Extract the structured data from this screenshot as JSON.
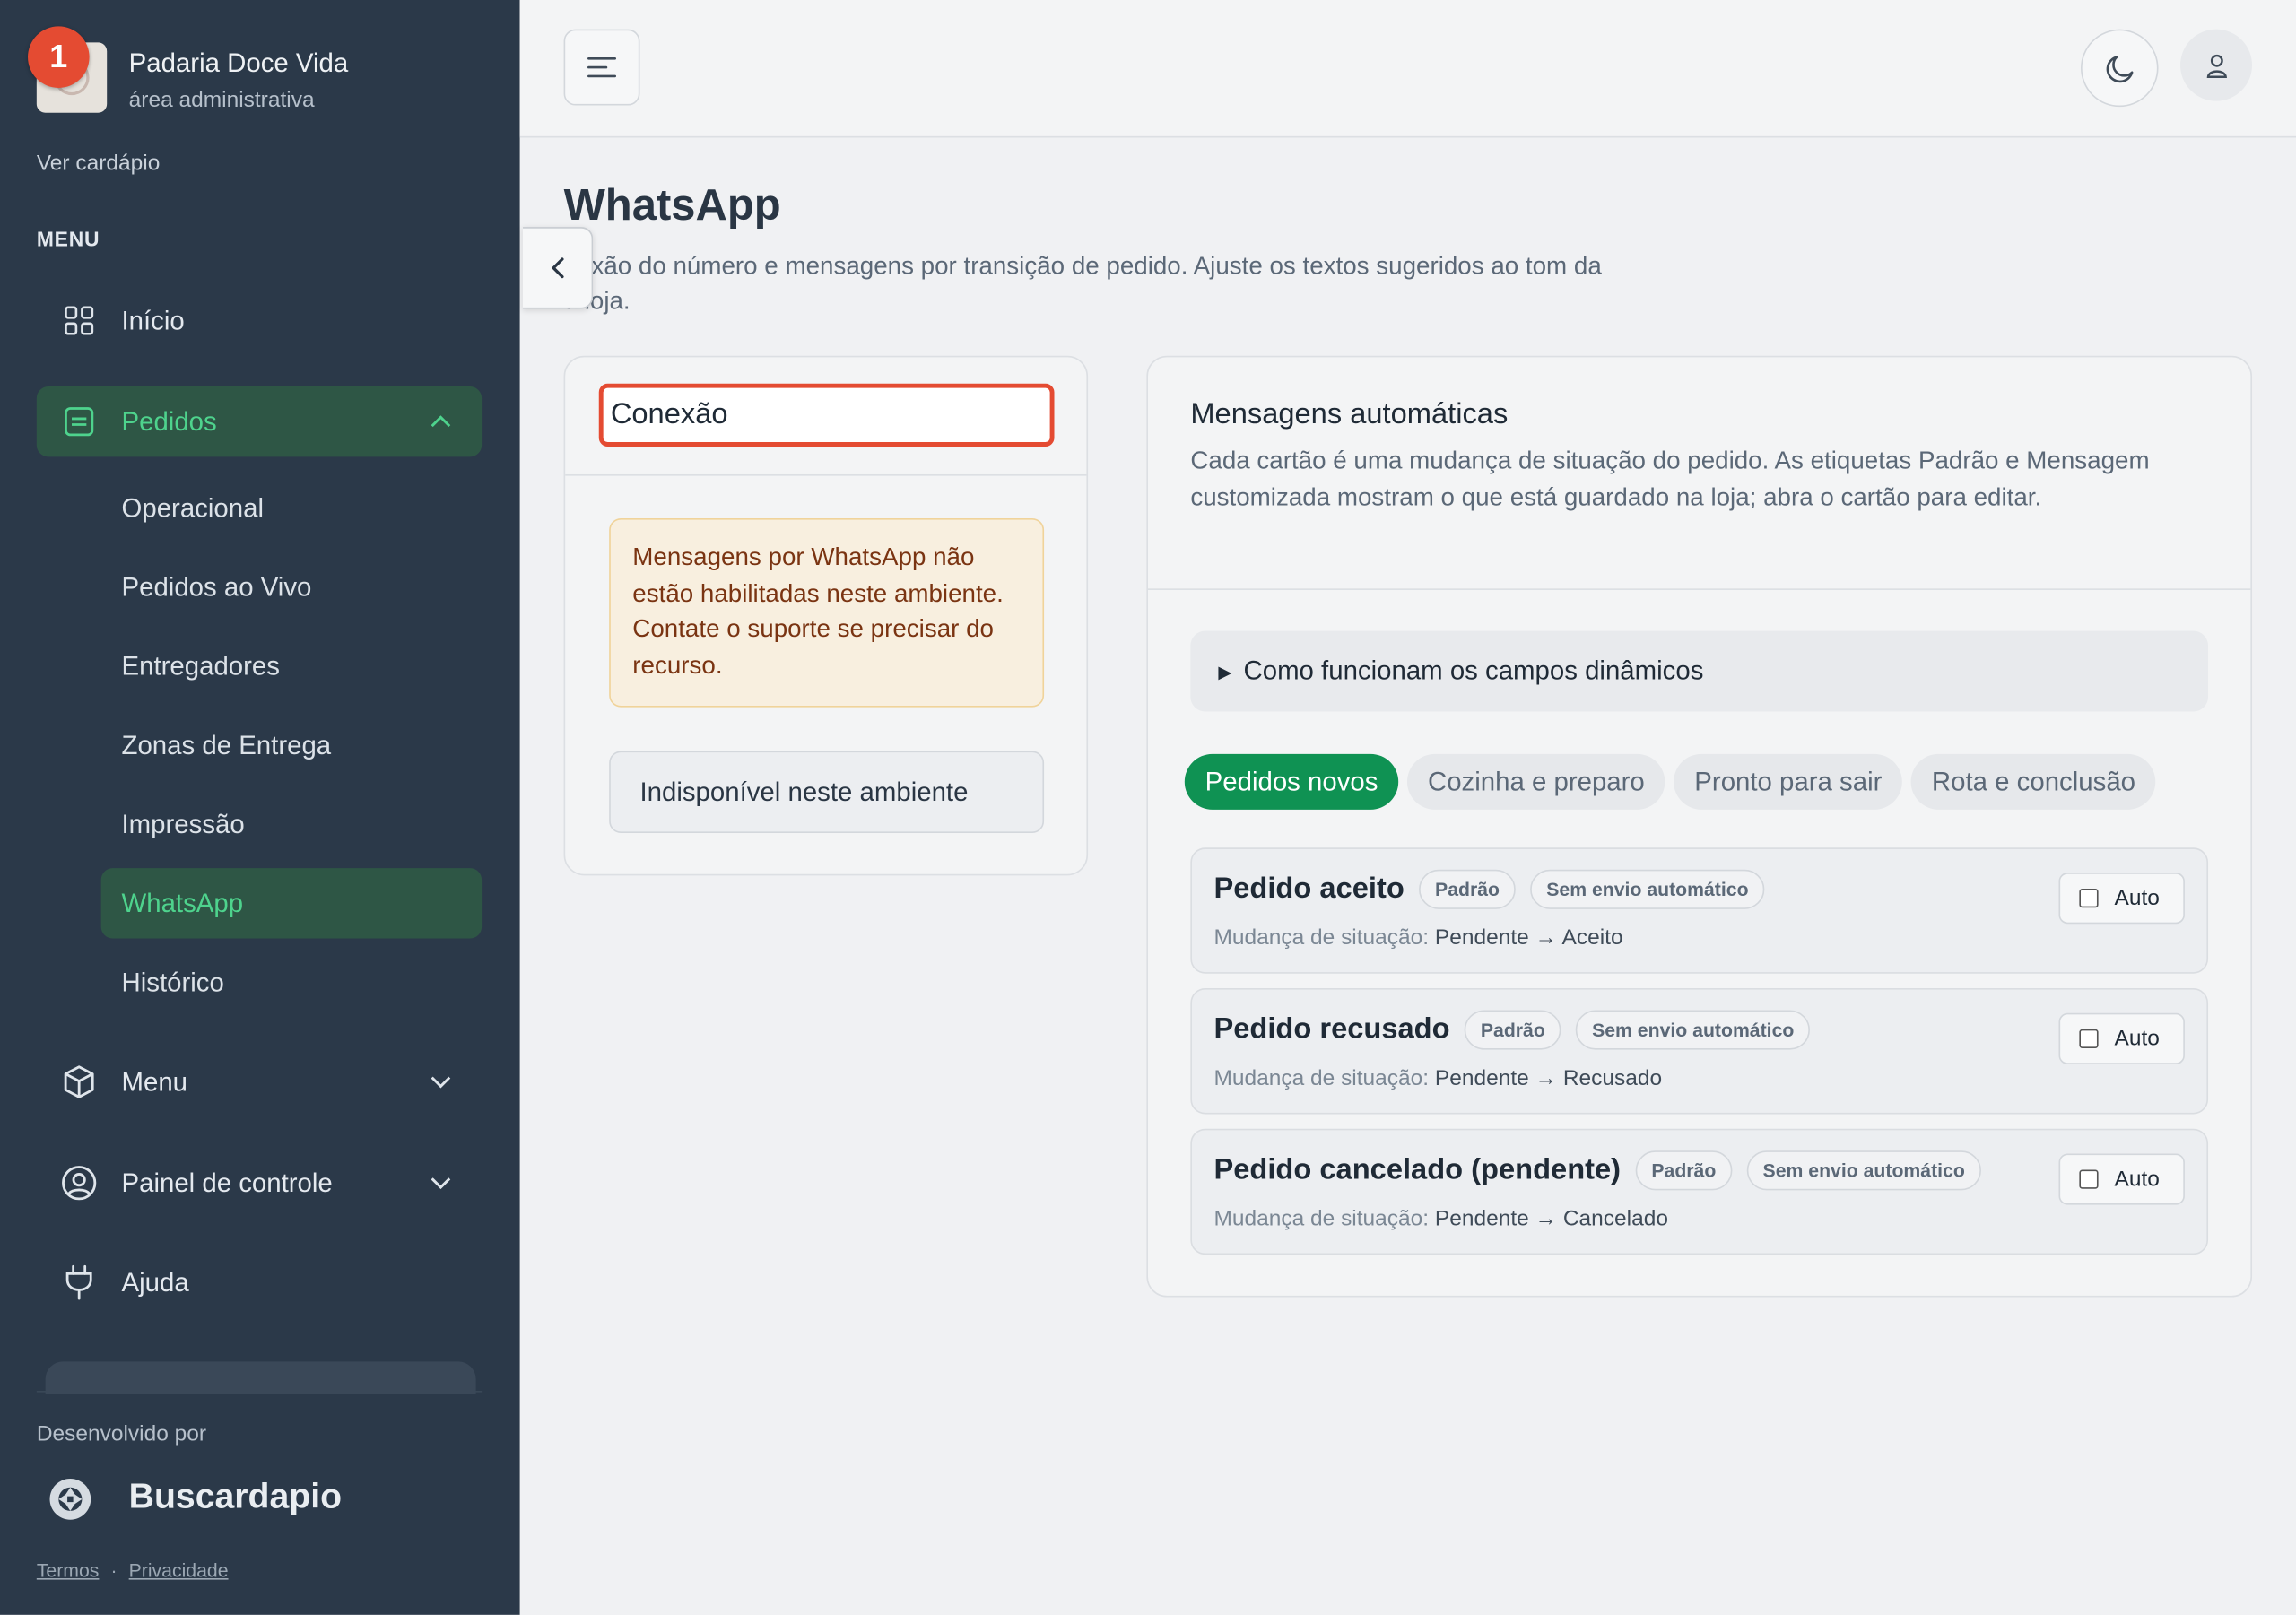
{
  "brand": {
    "name": "Padaria Doce Vida",
    "subtitle": "área administrativa",
    "notification_count": "1"
  },
  "sidebar": {
    "view_menu_link": "Ver cardápio",
    "menu_heading": "MENU",
    "items": [
      {
        "label": "Início",
        "icon": "grid-icon"
      },
      {
        "label": "Pedidos",
        "icon": "clipboard-icon",
        "expanded": true
      },
      {
        "label": "Menu",
        "icon": "box-icon"
      },
      {
        "label": "Painel de controle",
        "icon": "user-circle-icon"
      },
      {
        "label": "Ajuda",
        "icon": "plug-icon"
      }
    ],
    "pedidos_subitems": [
      "Operacional",
      "Pedidos ao Vivo",
      "Entregadores",
      "Zonas de Entrega",
      "Impressão",
      "WhatsApp",
      "Histórico"
    ],
    "active_subitem": "WhatsApp",
    "developed_by": "Desenvolvido por",
    "developer_name": "Buscardapio",
    "links": {
      "terms": "Termos",
      "privacy": "Privacidade",
      "separator": "·"
    }
  },
  "page": {
    "title": "WhatsApp",
    "description_line1": "nexão do número e mensagens por transição de pedido. Ajuste os textos sugeridos ao tom da",
    "description_line2": "a loja."
  },
  "connection": {
    "title": "Conexão",
    "warning": "Mensagens por WhatsApp não estão habilitadas neste ambiente. Contate o suporte se precisar do recurso.",
    "button": "Indisponível neste ambiente"
  },
  "messages": {
    "title": "Mensagens automáticas",
    "description": "Cada cartão é uma mudança de situação do pedido. As etiquetas Padrão e Mensagem customizada mostram o que está guardado na loja; abra o cartão para editar.",
    "details_label": "Como funcionam os campos dinâmicos",
    "tabs": [
      "Pedidos novos",
      "Cozinha e preparo",
      "Pronto para sair",
      "Rota e conclusão"
    ],
    "active_tab": "Pedidos novos",
    "change_label": "Mudança de situação:",
    "auto_label": "Auto",
    "cards": [
      {
        "title": "Pedido aceito",
        "tag1": "Padrão",
        "tag2": "Sem envio automático",
        "transition": "Pendente → Aceito",
        "auto_checked": false
      },
      {
        "title": "Pedido recusado",
        "tag1": "Padrão",
        "tag2": "Sem envio automático",
        "transition": "Pendente → Recusado",
        "auto_checked": false
      },
      {
        "title": "Pedido cancelado (pendente)",
        "tag1": "Padrão",
        "tag2": "Sem envio automático",
        "transition": "Pendente → Cancelado",
        "auto_checked": false
      }
    ]
  },
  "colors": {
    "sidebar_bg": "#2b3949",
    "accent_green": "#0f9253",
    "active_text": "#4ed38d",
    "badge_red": "#e44b32"
  }
}
